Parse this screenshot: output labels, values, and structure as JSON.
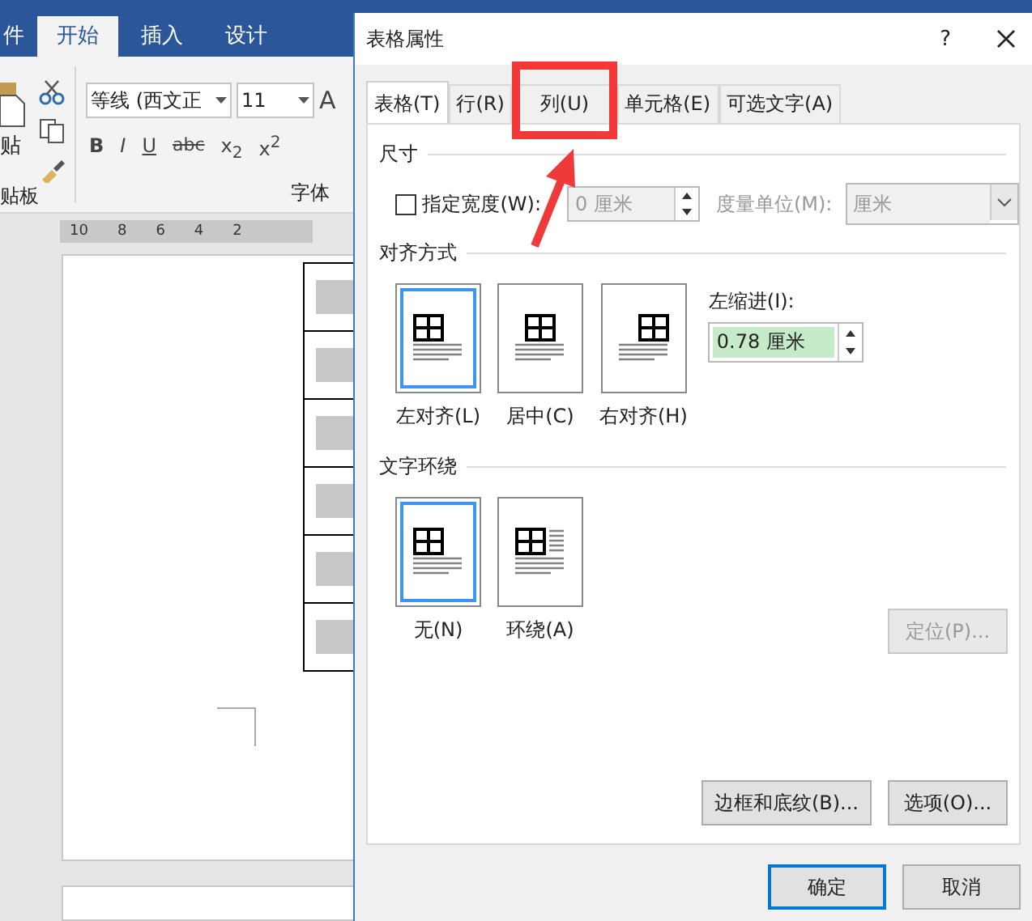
{
  "word": {
    "ribbon_tabs": [
      {
        "label": "件",
        "selected": false
      },
      {
        "label": "开始",
        "selected": true
      },
      {
        "label": "插入",
        "selected": false
      },
      {
        "label": "设计",
        "selected": false
      }
    ],
    "clipboard": {
      "paste_label": "贴",
      "group_label": "贴板"
    },
    "font": {
      "name": "等线 (西文正",
      "size": "11",
      "grow": "A",
      "buttons": [
        "B",
        "I",
        "U",
        "abc",
        "x$_{2}$",
        "x$^{2}$"
      ],
      "group_label": "字体"
    },
    "ruler_ticks": [
      "10",
      "8",
      "6",
      "4",
      "2"
    ],
    "table_rows": [
      {
        "kind": "shaded"
      },
      {
        "kind": "shaded"
      },
      {
        "kind": "shaded"
      },
      {
        "kind": "shaded"
      },
      {
        "kind": "shaded"
      },
      {
        "kind": "shaded"
      }
    ]
  },
  "dialog": {
    "title": "表格属性",
    "help": "?",
    "tabs": [
      {
        "label": "表格(T)",
        "selected": true,
        "highlighted": false
      },
      {
        "label": "行(R)",
        "selected": false,
        "highlighted": false
      },
      {
        "label": "列(U)",
        "selected": false,
        "highlighted": true
      },
      {
        "label": "单元格(E)",
        "selected": false,
        "highlighted": false
      },
      {
        "label": "可选文字(A)",
        "selected": false,
        "highlighted": false
      }
    ],
    "size": {
      "heading": "尺寸",
      "width_checkbox": {
        "label": "指定宽度(W):",
        "checked": false
      },
      "width_field": {
        "value": "0 厘米",
        "disabled": true
      },
      "unit_label": "度量单位(M):",
      "unit_select": {
        "value": "厘米",
        "disabled": true
      }
    },
    "alignment": {
      "heading": "对齐方式",
      "options": [
        {
          "label": "左对齐(L)",
          "kind": "left",
          "selected": true
        },
        {
          "label": "居中(C)",
          "kind": "center",
          "selected": false
        },
        {
          "label": "右对齐(H)",
          "kind": "right",
          "selected": false
        }
      ],
      "indent_label": "左缩进(I):",
      "indent_field": {
        "value": "0.78 厘米"
      }
    },
    "wrapping": {
      "heading": "文字环绕",
      "options": [
        {
          "label": "无(N)",
          "kind": "none",
          "selected": true
        },
        {
          "label": "环绕(A)",
          "kind": "around",
          "selected": false
        }
      ],
      "position_button": {
        "label": "定位(P)...",
        "disabled": true
      }
    },
    "panel_buttons": [
      "边框和底纹(B)...",
      "选项(O)..."
    ],
    "footer_buttons": [
      {
        "label": "确定",
        "default": true
      },
      {
        "label": "取消",
        "default": false
      }
    ]
  }
}
